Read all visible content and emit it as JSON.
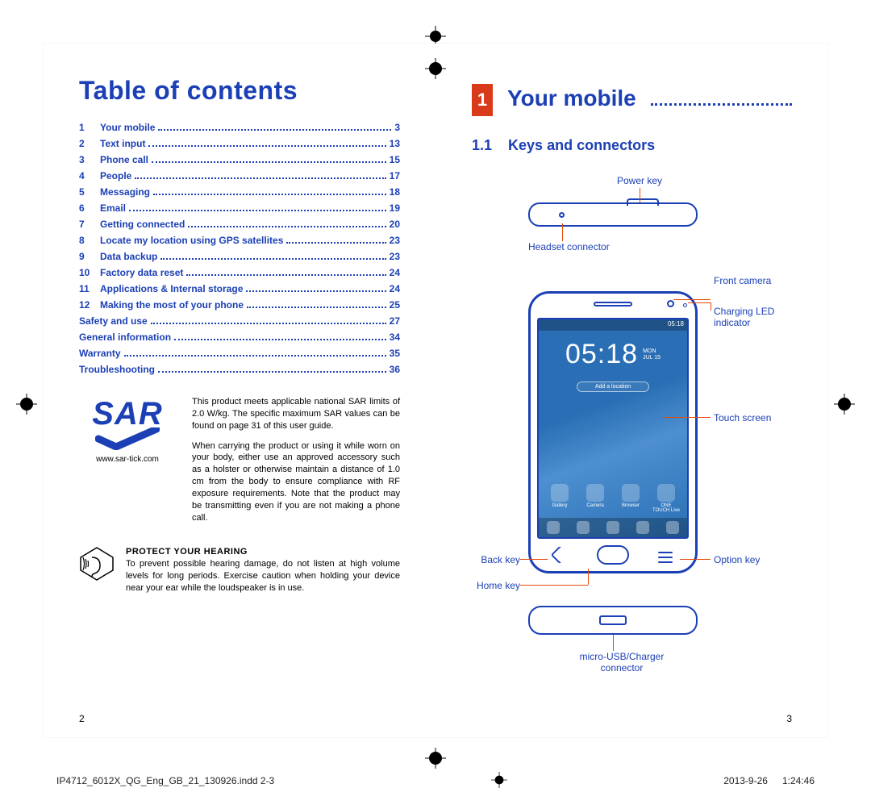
{
  "left": {
    "title": "Table of contents",
    "toc": [
      {
        "num": "1",
        "label": "Your mobile",
        "page": "3"
      },
      {
        "num": "2",
        "label": "Text input",
        "page": "13"
      },
      {
        "num": "3",
        "label": "Phone call",
        "page": "15"
      },
      {
        "num": "4",
        "label": "People",
        "page": "17"
      },
      {
        "num": "5",
        "label": "Messaging",
        "page": "18"
      },
      {
        "num": "6",
        "label": "Email",
        "page": "19"
      },
      {
        "num": "7",
        "label": "Getting connected",
        "page": "20"
      },
      {
        "num": "8",
        "label": "Locate my location using GPS satellites",
        "page": "23"
      },
      {
        "num": "9",
        "label": "Data backup",
        "page": "23"
      },
      {
        "num": "10",
        "label": "Factory data reset",
        "page": "24"
      },
      {
        "num": "11",
        "label": "Applications & Internal storage",
        "page": "24"
      },
      {
        "num": "12",
        "label": "Making the most of your phone",
        "page": "25"
      }
    ],
    "toc_trailing": [
      {
        "label": "Safety and use",
        "page": "27"
      },
      {
        "label": "General information",
        "page": "34"
      },
      {
        "label": "Warranty",
        "page": "35"
      },
      {
        "label": "Troubleshooting",
        "page": "36"
      }
    ],
    "sar": {
      "logo": "SAR",
      "url": "www.sar-tick.com",
      "para1": "This product meets applicable national SAR limits of 2.0 W/kg. The specific maximum SAR values can be found on page 31 of this user guide.",
      "para2": "When carrying the product or using it while worn on your body, either use an approved accessory such as a holster or otherwise maintain a distance of 1.0 cm from the body to ensure compliance with RF exposure requirements. Note that the product may be transmitting even if you are not making a phone call."
    },
    "hearing": {
      "heading": "PROTECT YOUR HEARING",
      "body": "To prevent possible hearing damage, do not listen at high volume levels for long periods. Exercise caution when holding your device near your ear while the loudspeaker is in use."
    },
    "page_number": "2"
  },
  "right": {
    "chapter_number": "1",
    "chapter_title": "Your mobile",
    "section_number": "1.1",
    "section_title": "Keys and connectors",
    "labels": {
      "power_key": "Power key",
      "headset": "Headset connector",
      "front_camera": "Front camera",
      "charging_led": "Charging LED indicator",
      "touch_screen": "Touch screen",
      "back_key": "Back key",
      "home_key": "Home key",
      "option_key": "Option key",
      "usb": "micro-USB/Charger connector"
    },
    "screen": {
      "status_time": "05:18",
      "clock": "05:18",
      "day": "MON",
      "date": "JUL 15",
      "add_location": "Add a location",
      "apps": [
        "Gallery",
        "Camera",
        "Browser",
        "ONE TOUCH Live"
      ]
    },
    "page_number": "3"
  },
  "footer": {
    "file": "IP4712_6012X_QG_Eng_GB_21_130926.indd   2-3",
    "date": "2013-9-26",
    "time": "1:24:46"
  }
}
